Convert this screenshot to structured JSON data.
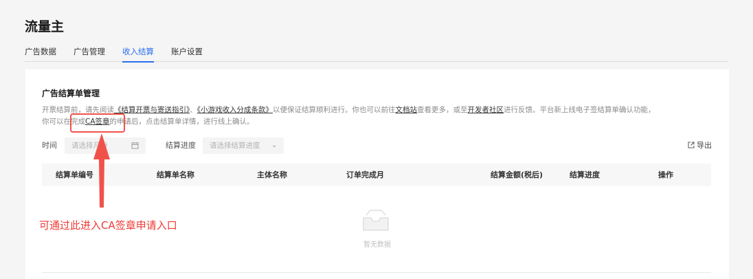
{
  "app": {
    "title": "流量主"
  },
  "tabs": [
    {
      "label": "广告数据"
    },
    {
      "label": "广告管理"
    },
    {
      "label": "收入结算",
      "active": true
    },
    {
      "label": "账户设置"
    }
  ],
  "section": {
    "title": "广告结算单管理",
    "desc": {
      "p1": "开票结算前，请先阅读",
      "link1": "《结算开票与寄送指引》",
      "p2": "、",
      "link2": "《小游戏收入分成条款》",
      "p3": "以便保证结算顺利进行。你也可以前往",
      "link3": "文档站",
      "p4": "查看更多，或至",
      "link4": "开发者社区",
      "p5": "进行反馈。平台新上线电子签结算单确认功能，",
      "p6": "你可以在完成",
      "link5": "CA签章",
      "p7": "的申请后，点击结算单详情，进行线上确认。"
    }
  },
  "filters": {
    "time_label": "时间",
    "time_placeholder": "请选择月份",
    "progress_label": "结算进度",
    "progress_placeholder": "请选择结算进度",
    "export_label": "导出"
  },
  "table": {
    "columns": [
      "结算单编号",
      "结算单名称",
      "主体名称",
      "订单完成月",
      "结算金额(税后)",
      "结算进度",
      "操作"
    ],
    "rows": [],
    "empty_text": "暂无数据"
  },
  "annotation": {
    "text": "可通过此进入CA签章申请入口",
    "color": "#ee3a34"
  },
  "colors": {
    "accent": "#2b6ff2",
    "annotation": "#f0524a"
  },
  "icons": {
    "calendar": "calendar-icon",
    "chevron": "chevron-down-icon",
    "export": "export-icon",
    "empty": "empty-inbox-icon"
  }
}
